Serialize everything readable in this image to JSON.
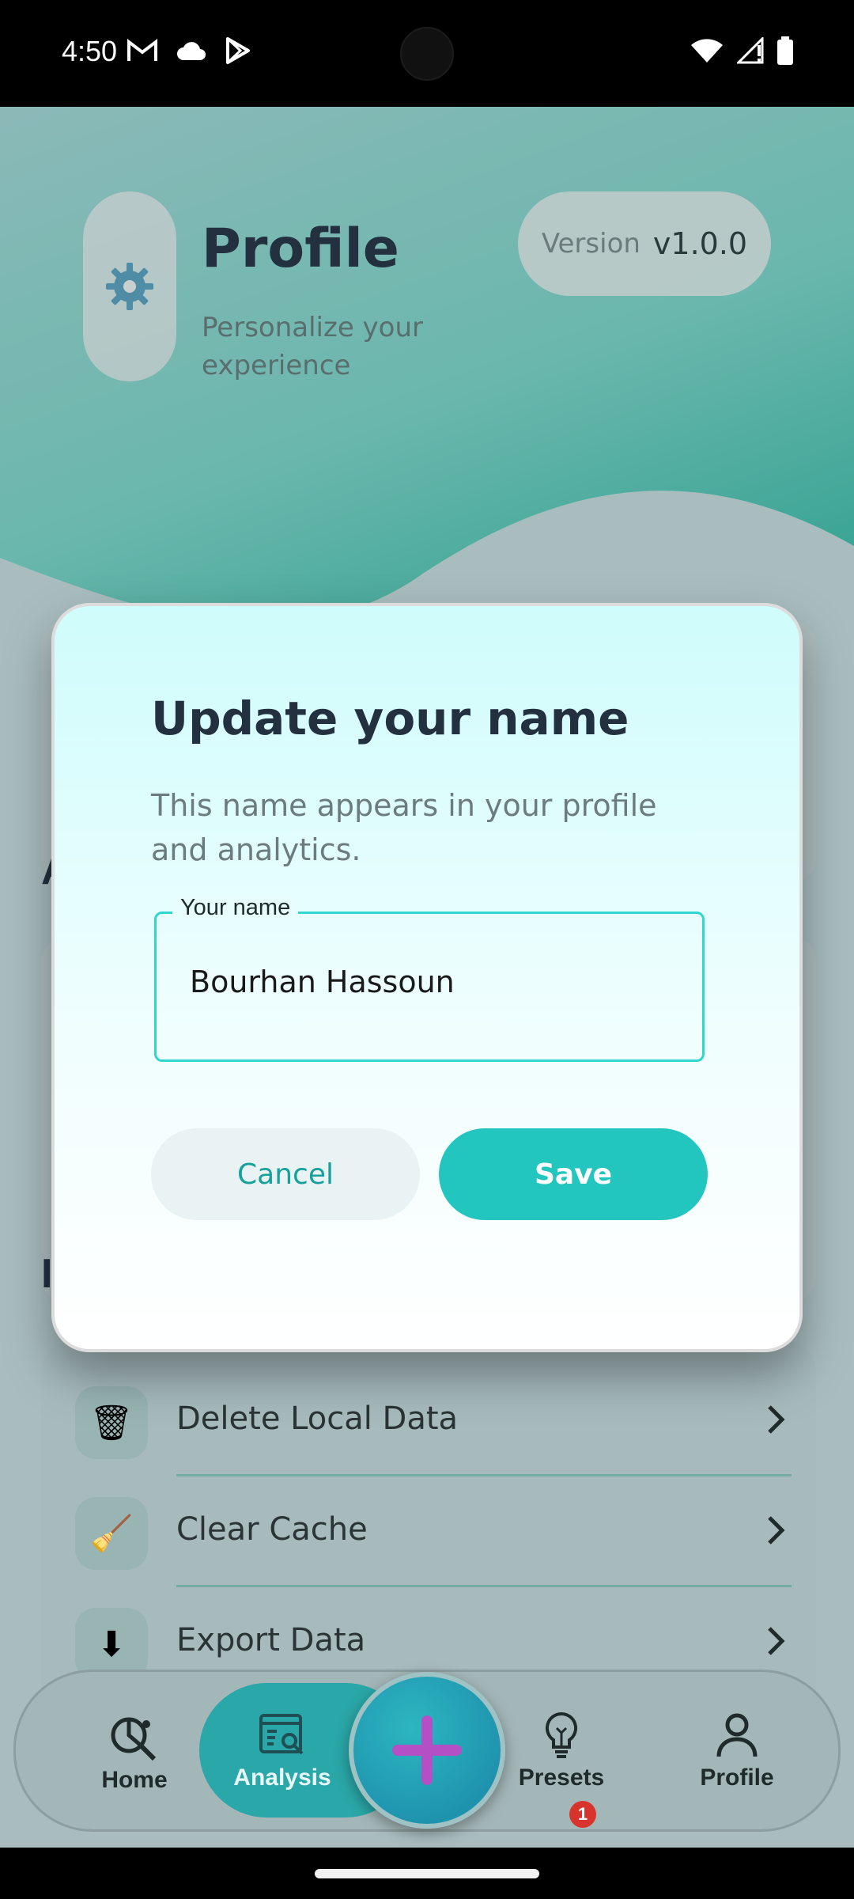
{
  "status_bar": {
    "time": "4:50",
    "left_icons": [
      "gmail-icon",
      "cloud-icon",
      "play-store-icon"
    ],
    "right_icons": [
      "wifi-icon",
      "signal-icon",
      "battery-icon"
    ]
  },
  "header": {
    "title": "Profile",
    "subtitle": "Personalize your experience",
    "version_label": "Version",
    "version_value": "v1.0.0"
  },
  "background": {
    "peek_letter_1": "A",
    "peek_letter_2": "I"
  },
  "data_list": {
    "items": [
      {
        "label": "Delete Local Data",
        "icon": "trash-icon",
        "glyph": "🗑"
      },
      {
        "label": "Clear Cache",
        "icon": "broom-icon",
        "glyph": "🧹"
      },
      {
        "label": "Export Data",
        "icon": "download-icon",
        "glyph": "⬇"
      }
    ]
  },
  "dialog": {
    "title": "Update your name",
    "description": "This name appears in your profile and analytics.",
    "field_label": "Your name",
    "field_value": "Bourhan Hassoun",
    "cancel_label": "Cancel",
    "save_label": "Save"
  },
  "nav": {
    "items": [
      {
        "label": "Home",
        "icon": "home-analytics-icon"
      },
      {
        "label": "Analysis",
        "icon": "analysis-icon",
        "active": true
      },
      {
        "label": "Presets",
        "icon": "lightbulb-icon",
        "badge": "1"
      },
      {
        "label": "Profile",
        "icon": "person-icon"
      }
    ],
    "fab_icon": "plus-icon"
  },
  "colors": {
    "accent": "#23c6be",
    "title": "#22303f",
    "badge": "#d8332c",
    "fab_plus": "#b44fc6"
  }
}
